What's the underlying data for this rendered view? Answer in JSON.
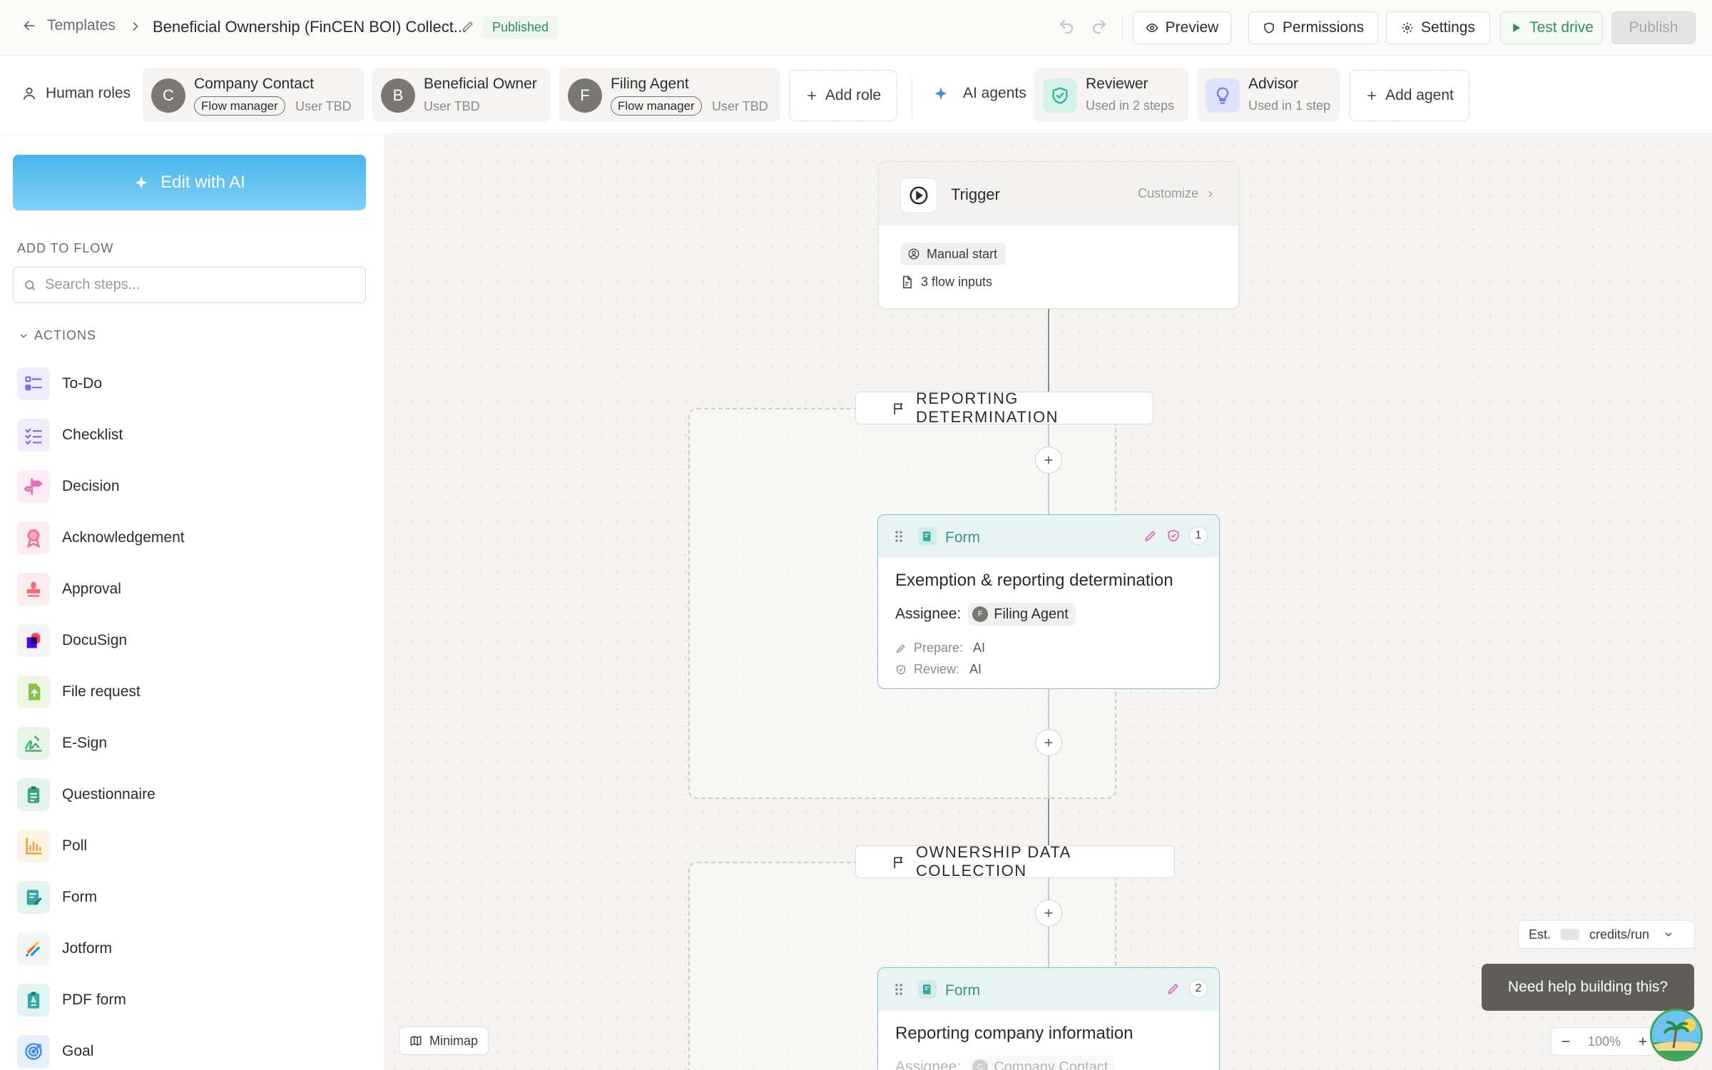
{
  "topbar": {
    "back_label": "Templates",
    "title": "Beneficial Ownership (FinCEN BOI) Collect...",
    "status": "Published",
    "preview": "Preview",
    "permissions": "Permissions",
    "settings": "Settings",
    "test_drive": "Test drive",
    "publish": "Publish"
  },
  "roles": {
    "human_label": "Human roles",
    "items": [
      {
        "initial": "C",
        "name": "Company Contact",
        "tag": "Flow manager",
        "user": "User TBD"
      },
      {
        "initial": "B",
        "name": "Beneficial Owner",
        "tag": "",
        "user": "User TBD"
      },
      {
        "initial": "F",
        "name": "Filing Agent",
        "tag": "Flow manager",
        "user": "User TBD"
      }
    ],
    "add_role": "Add role",
    "ai_label": "AI agents",
    "agents": [
      {
        "name": "Reviewer",
        "usage": "Used in 2 steps",
        "icon": "shield-check-icon",
        "color": "#2fb59d"
      },
      {
        "name": "Advisor",
        "usage": "Used in 1 step",
        "icon": "lightbulb-icon",
        "color": "#6e7cf0"
      }
    ],
    "add_agent": "Add agent"
  },
  "sidebar": {
    "edit_ai": "Edit with AI",
    "add_to_flow": "ADD TO FLOW",
    "search_placeholder": "Search steps...",
    "actions_header": "ACTIONS",
    "actions": [
      {
        "label": "To-Do",
        "icon": "todo-icon",
        "color": "#7b6cf0"
      },
      {
        "label": "Checklist",
        "icon": "checklist-icon",
        "color": "#8e6cf0"
      },
      {
        "label": "Decision",
        "icon": "decision-icon",
        "color": "#e86fb6"
      },
      {
        "label": "Acknowledgement",
        "icon": "ribbon-icon",
        "color": "#ef6fa0"
      },
      {
        "label": "Approval",
        "icon": "stamp-icon",
        "color": "#ef6f7c"
      },
      {
        "label": "DocuSign",
        "icon": "docusign-icon",
        "color": "#f23a58"
      },
      {
        "label": "File request",
        "icon": "file-upload-icon",
        "color": "#8bc34a"
      },
      {
        "label": "E-Sign",
        "icon": "signature-icon",
        "color": "#4caf72"
      },
      {
        "label": "Questionnaire",
        "icon": "clipboard-icon",
        "color": "#3aa57a"
      },
      {
        "label": "Poll",
        "icon": "bar-chart-icon",
        "color": "#f0a23a"
      },
      {
        "label": "Form",
        "icon": "form-icon",
        "color": "#35a7a2"
      },
      {
        "label": "Jotform",
        "icon": "jotform-icon",
        "color": "#ff6100"
      },
      {
        "label": "PDF form",
        "icon": "pdf-form-icon",
        "color": "#2eaaa8"
      },
      {
        "label": "Goal",
        "icon": "target-icon",
        "color": "#4a90e2"
      }
    ]
  },
  "canvas": {
    "trigger": {
      "title": "Trigger",
      "customize": "Customize",
      "start": "Manual start",
      "inputs": "3 flow inputs"
    },
    "groups": [
      {
        "label": "REPORTING DETERMINATION"
      },
      {
        "label": "OWNERSHIP DATA COLLECTION"
      }
    ],
    "steps": [
      {
        "type": "Form",
        "number": "1",
        "title": "Exemption & reporting determination",
        "assignee_label": "Assignee:",
        "assignee": "Filing Agent",
        "assignee_initial": "F",
        "prepare_label": "Prepare:",
        "prepare": "AI",
        "review_label": "Review:",
        "review": "AI"
      },
      {
        "type": "Form",
        "number": "2",
        "title": "Reporting company information",
        "assignee_label": "Assignee:",
        "assignee": "Company Contact",
        "assignee_initial": "C"
      }
    ],
    "minimap": "Minimap",
    "credits_est": "Est.",
    "credits_unit": "credits/run",
    "help": "Need help building this?",
    "zoom": "100%"
  }
}
